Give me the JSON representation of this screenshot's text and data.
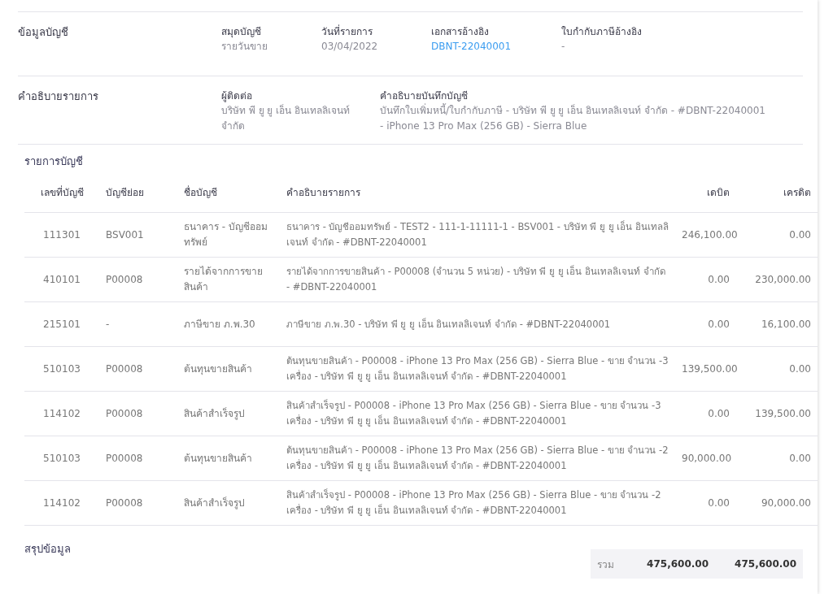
{
  "account_info": {
    "heading": "ข้อมูลบัญชี",
    "fields": [
      {
        "label": "สมุดบัญชี",
        "value": "รายวันขาย",
        "kind": "text"
      },
      {
        "label": "วันที่รายการ",
        "value": "03/04/2022",
        "kind": "text"
      },
      {
        "label": "เอกสารอ้างอิง",
        "value": "DBNT-22040001",
        "kind": "link"
      },
      {
        "label": "ใบกำกับภาษีอ้างอิง",
        "value": "-",
        "kind": "text"
      }
    ]
  },
  "description": {
    "heading": "คำอธิบายรายการ",
    "fields": [
      {
        "label": "ผู้ติดต่อ",
        "value": "บริษัท พี ยู ยู เอ็น อินเทลลิเจนท์ จำกัด"
      },
      {
        "label": "คำอธิบายบันทึกบัญชี",
        "value": "บันทึกใบเพิ่มหนี้/ใบกำกับภาษี - บริษัท พี ยู ยู เอ็น อินเทลลิเจนท์ จำกัด - #DBNT-22040001 - iPhone 13 Pro Max (256 GB) - Sierra Blue"
      }
    ]
  },
  "table": {
    "title": "รายการบัญชี",
    "columns": [
      "เลขที่บัญชี",
      "บัญชีย่อย",
      "ชื่อบัญชี",
      "คำอธิบายรายการ",
      "เดบิต",
      "เครดิต"
    ],
    "rows": [
      [
        "111301",
        "BSV001",
        "ธนาคาร - บัญชีออมทรัพย์",
        "ธนาคาร - บัญชีออมทรัพย์ - TEST2 - 111-1-11111-1 - BSV001 - บริษัท พี ยู ยู เอ็น อินเทลลิเจนท์ จำกัด - #DBNT-22040001",
        "246,100.00",
        "0.00"
      ],
      [
        "410101",
        "P00008",
        "รายได้จากการขายสินค้า",
        "รายได้จากการขายสินค้า - P00008 (จำนวน 5 หน่วย) - บริษัท พี ยู ยู เอ็น อินเทลลิเจนท์ จำกัด - #DBNT-22040001",
        "0.00",
        "230,000.00"
      ],
      [
        "215101",
        "-",
        "ภาษีขาย ภ.พ.30",
        "ภาษีขาย ภ.พ.30 - บริษัท พี ยู ยู เอ็น อินเทลลิเจนท์ จำกัด - #DBNT-22040001",
        "0.00",
        "16,100.00"
      ],
      [
        "510103",
        "P00008",
        "ต้นทุนขายสินค้า",
        "ต้นทุนขายสินค้า - P00008 - iPhone 13 Pro Max (256 GB) - Sierra Blue - ขาย จำนวน -3 เครื่อง - บริษัท พี ยู ยู เอ็น อินเทลลิเจนท์ จำกัด - #DBNT-22040001",
        "139,500.00",
        "0.00"
      ],
      [
        "114102",
        "P00008",
        "สินค้าสำเร็จรูป",
        "สินค้าสำเร็จรูป - P00008 - iPhone 13 Pro Max (256 GB) - Sierra Blue - ขาย จำนวน -3 เครื่อง - บริษัท พี ยู ยู เอ็น อินเทลลิเจนท์ จำกัด - #DBNT-22040001",
        "0.00",
        "139,500.00"
      ],
      [
        "510103",
        "P00008",
        "ต้นทุนขายสินค้า",
        "ต้นทุนขายสินค้า - P00008 - iPhone 13 Pro Max (256 GB) - Sierra Blue - ขาย จำนวน -2 เครื่อง - บริษัท พี ยู ยู เอ็น อินเทลลิเจนท์ จำกัด - #DBNT-22040001",
        "90,000.00",
        "0.00"
      ],
      [
        "114102",
        "P00008",
        "สินค้าสำเร็จรูป",
        "สินค้าสำเร็จรูป - P00008 - iPhone 13 Pro Max (256 GB) - Sierra Blue - ขาย จำนวน -2 เครื่อง - บริษัท พี ยู ยู เอ็น อินเทลลิเจนท์ จำกัด - #DBNT-22040001",
        "0.00",
        "90,000.00"
      ]
    ]
  },
  "summary": {
    "title": "สรุปข้อมูล",
    "total_label": "รวม",
    "total_debit": "475,600.00",
    "total_credit": "475,600.00"
  }
}
